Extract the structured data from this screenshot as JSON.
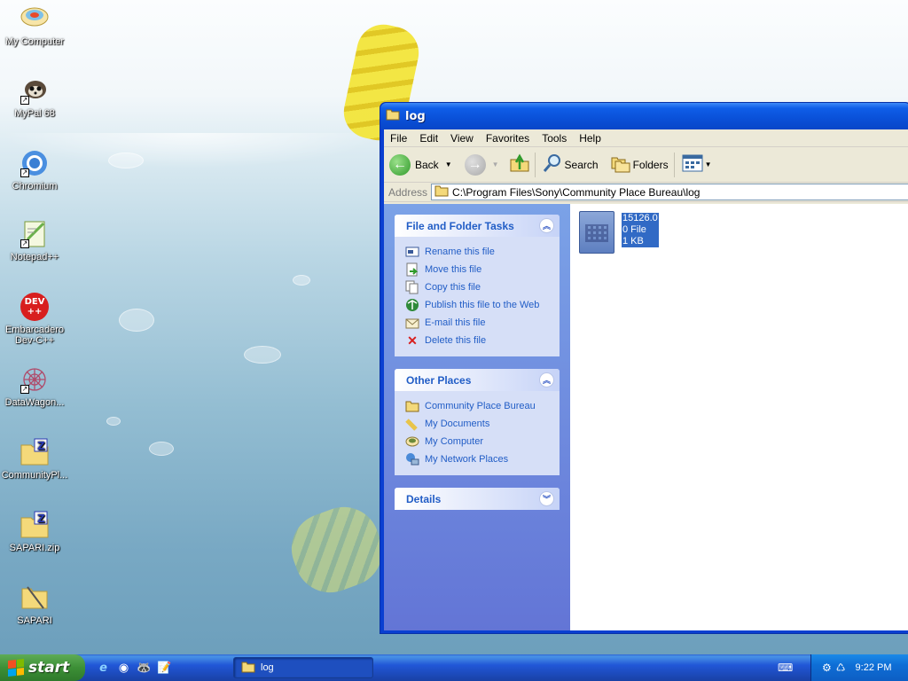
{
  "desktop": {
    "icons": [
      {
        "label": "My Computer",
        "icon": "my-computer-icon"
      },
      {
        "label": "MyPal 68",
        "icon": "mypal-icon"
      },
      {
        "label": "Chromium",
        "icon": "chromium-icon"
      },
      {
        "label": "Notepad++",
        "icon": "notepadpp-icon"
      },
      {
        "label": "Embarcadero Dev-C++",
        "icon": "devcpp-icon"
      },
      {
        "label": "DataWagon...",
        "icon": "datawagon-icon"
      },
      {
        "label": "CommunityPl...",
        "icon": "zip-folder-icon"
      },
      {
        "label": "SAPARI.zip",
        "icon": "zip-folder-icon"
      },
      {
        "label": "SAPARI",
        "icon": "folder-icon"
      }
    ],
    "dev_badge": {
      "line1": "DEV",
      "line2": "++"
    }
  },
  "window": {
    "title": "log",
    "menu": [
      "File",
      "Edit",
      "View",
      "Favorites",
      "Tools",
      "Help"
    ],
    "toolbar": {
      "back": "Back",
      "search": "Search",
      "folders": "Folders"
    },
    "address": {
      "label": "Address",
      "value": "C:\\Program Files\\Sony\\Community Place Bureau\\log"
    },
    "file_tasks": {
      "title": "File and Folder Tasks",
      "items": [
        {
          "label": "Rename this file",
          "icon": "rename-icon"
        },
        {
          "label": "Move this file",
          "icon": "move-icon"
        },
        {
          "label": "Copy this file",
          "icon": "copy-icon"
        },
        {
          "label": "Publish this file to the Web",
          "icon": "publish-icon"
        },
        {
          "label": "E-mail this file",
          "icon": "email-icon"
        },
        {
          "label": "Delete this file",
          "icon": "delete-icon"
        }
      ]
    },
    "other_places": {
      "title": "Other Places",
      "items": [
        {
          "label": "Community Place Bureau",
          "icon": "folder-icon"
        },
        {
          "label": "My Documents",
          "icon": "my-documents-icon"
        },
        {
          "label": "My Computer",
          "icon": "my-computer-icon"
        },
        {
          "label": "My Network Places",
          "icon": "network-icon"
        }
      ]
    },
    "details": {
      "title": "Details"
    },
    "file": {
      "name": "15126.0",
      "type": "0 File",
      "size": "1 KB"
    }
  },
  "taskbar": {
    "start": "start",
    "task_button": "log",
    "clock": "9:22 PM"
  },
  "colors": {
    "xp_blue": "#0a50d8",
    "link_blue": "#215dc6",
    "start_green": "#3c8f36",
    "selection": "#316ac5"
  }
}
